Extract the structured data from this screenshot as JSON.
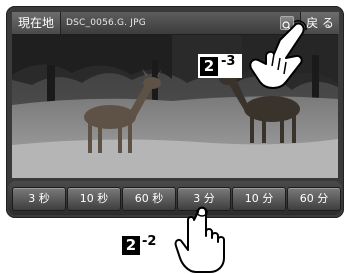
{
  "header": {
    "current_location_label": "現在地",
    "filename": "DSC_0056.G. JPG",
    "back_label": "戻 る",
    "zoom_icon": "magnifier-icon"
  },
  "intervals": [
    {
      "label": "3 秒"
    },
    {
      "label": "10 秒"
    },
    {
      "label": "60 秒"
    },
    {
      "label": "3 分"
    },
    {
      "label": "10 分"
    },
    {
      "label": "60 分"
    }
  ],
  "callouts": {
    "top": {
      "number": "2",
      "suffix": "-3"
    },
    "bottom": {
      "number": "2",
      "suffix": "-2"
    }
  },
  "colors": {
    "header_bg": "#4a4a4a",
    "button_bg": "#5c5c5c",
    "text": "#ffffff"
  }
}
